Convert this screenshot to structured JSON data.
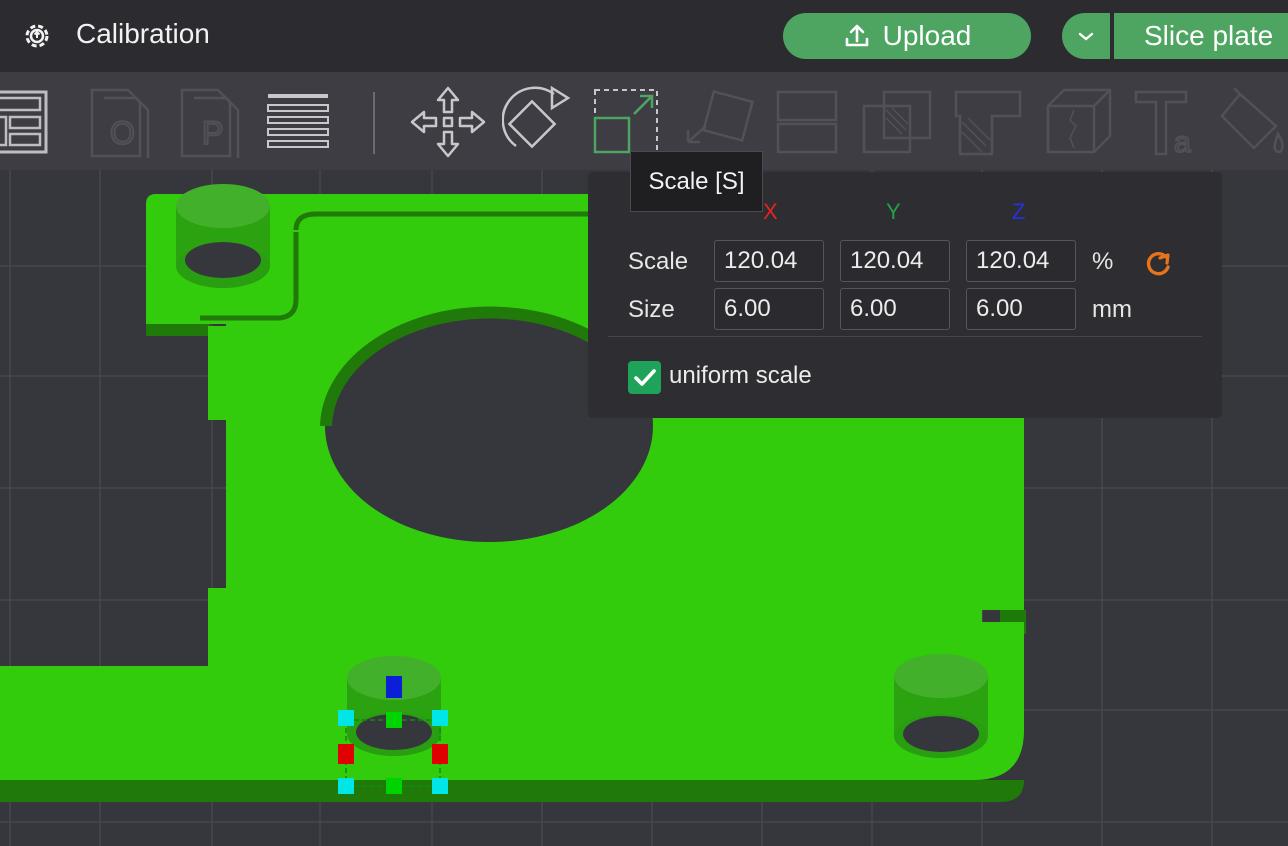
{
  "titlebar": {
    "title": "Calibration",
    "upload_label": "Upload",
    "slice_label": "Slice plate"
  },
  "toolbar": {
    "tools": [
      "arrange-icon",
      "orient-o-icon",
      "orient-p-icon",
      "layers-icon",
      "move-icon",
      "rotate-icon",
      "scale-icon",
      "lay-on-face-icon",
      "cut-icon",
      "boolean-icon",
      "support-paint-icon",
      "seam-paint-icon",
      "text-icon",
      "color-paint-icon"
    ]
  },
  "tooltip": {
    "text": "Scale [S]"
  },
  "scale_panel": {
    "axes": {
      "x": "X",
      "y": "Y",
      "z": "Z"
    },
    "scale_label": "Scale",
    "size_label": "Size",
    "scale_values": {
      "x": "120.04",
      "y": "120.04",
      "z": "120.04"
    },
    "size_values": {
      "x": "6.00",
      "y": "6.00",
      "z": "6.00"
    },
    "scale_unit": "%",
    "size_unit": "mm",
    "uniform_label": "uniform scale",
    "uniform_checked": true
  },
  "colors": {
    "accent": "#4ea562",
    "model": "#33cc0d",
    "model_shadow": "#1f7a0a",
    "background": "#36363d",
    "reset_icon": "#e8731a"
  }
}
